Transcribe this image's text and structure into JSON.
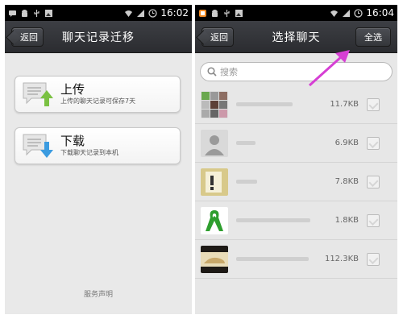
{
  "left": {
    "status": {
      "time": "16:02"
    },
    "nav": {
      "back_label": "返回",
      "title": "聊天记录迁移"
    },
    "upload": {
      "title": "上传",
      "subtitle": "上传的聊天记录可保存7天"
    },
    "download": {
      "title": "下载",
      "subtitle": "下载聊天记录到本机"
    },
    "service_label": "服务声明"
  },
  "right": {
    "status": {
      "time": "16:04"
    },
    "nav": {
      "back_label": "返回",
      "title": "选择聊天",
      "select_all_label": "全选"
    },
    "search": {
      "placeholder": "搜索"
    },
    "chats": [
      {
        "size": "11.7KB",
        "selected": false
      },
      {
        "size": "6.9KB",
        "selected": false
      },
      {
        "size": "7.8KB",
        "selected": false
      },
      {
        "size": "1.8KB",
        "selected": false
      },
      {
        "size": "112.3KB",
        "selected": false
      }
    ]
  },
  "colors": {
    "annotation_arrow": "#d63fd4",
    "upload_arrow": "#7ac142",
    "download_arrow": "#3b9be0"
  }
}
